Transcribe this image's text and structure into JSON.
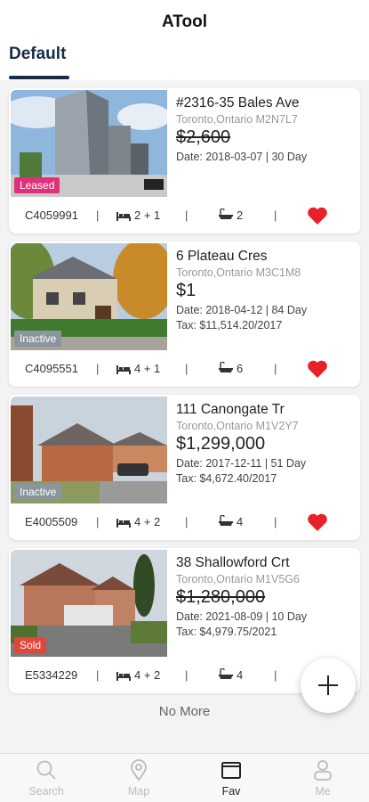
{
  "app": {
    "title": "ATool"
  },
  "tabs": [
    {
      "label": "Default"
    }
  ],
  "listings": [
    {
      "address": "#2316-35 Bales Ave",
      "city": "Toronto,Ontario M2N7L7",
      "price": "$2,600",
      "price_struck": true,
      "date_line": "Date: 2018-03-07 | 30 Day",
      "tax_line": "",
      "badge": "Leased",
      "badge_color": "#e0307a",
      "mls": "C4059991",
      "beds": "2 + 1",
      "baths": "2",
      "favorited": true
    },
    {
      "address": "6 Plateau Cres",
      "city": "Toronto,Ontario M3C1M8",
      "price": "$1",
      "price_struck": false,
      "date_line": "Date: 2018-04-12 | 84 Day",
      "tax_line": "Tax: $11,514.20/2017",
      "badge": "Inactive",
      "badge_color": "#8a969c",
      "mls": "C4095551",
      "beds": "4 + 1",
      "baths": "6",
      "favorited": true
    },
    {
      "address": "111 Canongate Tr",
      "city": "Toronto,Ontario M1V2Y7",
      "price": "$1,299,000",
      "price_struck": false,
      "date_line": "Date: 2017-12-11 | 51 Day",
      "tax_line": "Tax: $4,672.40/2017",
      "badge": "Inactive",
      "badge_color": "#8a969c",
      "mls": "E4005509",
      "beds": "4 + 2",
      "baths": "4",
      "favorited": true
    },
    {
      "address": "38 Shallowford Crt",
      "city": "Toronto,Ontario M1V5G6",
      "price": "$1,280,000",
      "price_struck": true,
      "date_line": "Date: 2021-08-09 | 10 Day",
      "tax_line": "Tax: $4,979.75/2021",
      "badge": "Sold",
      "badge_color": "#e0463a",
      "mls": "E5334229",
      "beds": "4 + 2",
      "baths": "4",
      "favorited": true
    }
  ],
  "footer": {
    "no_more": "No More"
  },
  "fab": {
    "icon": "plus-icon"
  },
  "nav": [
    {
      "label": "Search",
      "icon": "search-icon",
      "active": false
    },
    {
      "label": "Map",
      "icon": "map-pin-icon",
      "active": false
    },
    {
      "label": "Fav",
      "icon": "folder-icon",
      "active": true
    },
    {
      "label": "Me",
      "icon": "user-icon",
      "active": false
    }
  ],
  "colors": {
    "accent": "#1a2a4a",
    "heart": "#e8202a"
  }
}
